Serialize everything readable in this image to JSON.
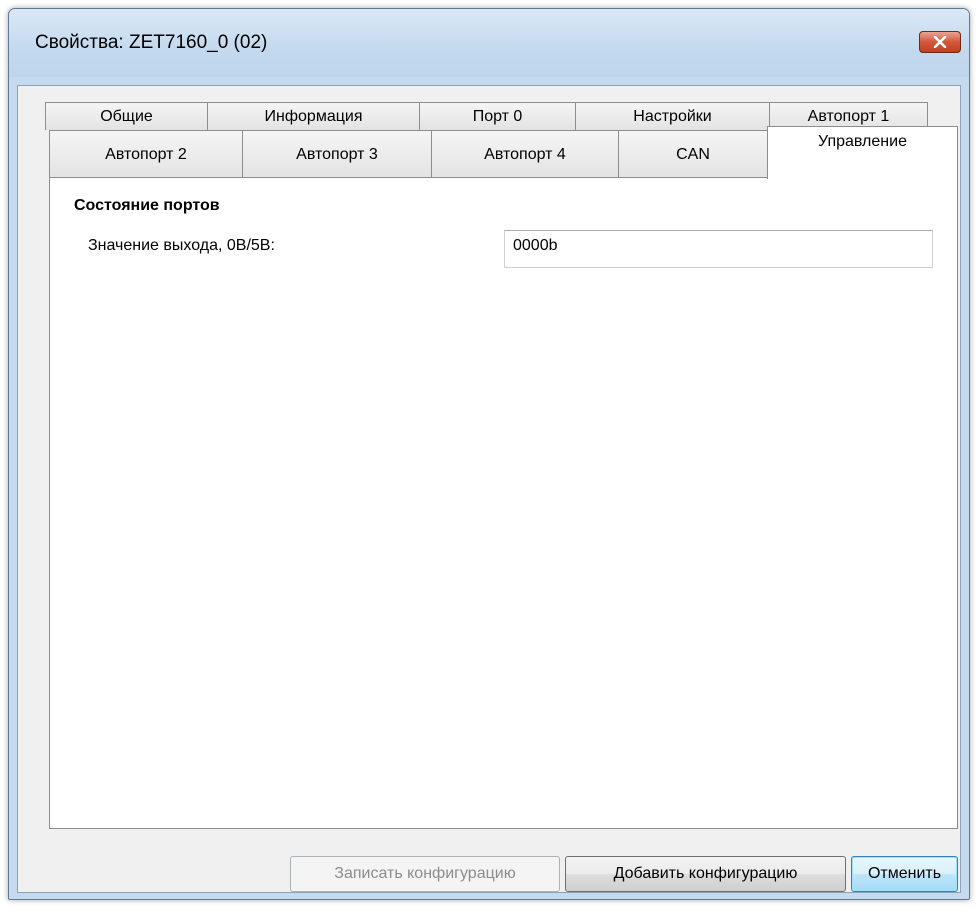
{
  "window": {
    "title": "Свойства: ZET7160_0 (02)"
  },
  "tabs": {
    "row1": [
      {
        "label": "Общие"
      },
      {
        "label": "Информация"
      },
      {
        "label": "Порт 0"
      },
      {
        "label": "Настройки"
      },
      {
        "label": "Автопорт 1"
      }
    ],
    "row2": [
      {
        "label": "Автопорт 2"
      },
      {
        "label": "Автопорт 3"
      },
      {
        "label": "Автопорт 4"
      },
      {
        "label": "CAN"
      },
      {
        "label": "Управление",
        "active": true
      }
    ]
  },
  "panel": {
    "section_title": "Состояние портов",
    "output_label": "Значение выхода, 0В/5В:",
    "output_value": "0000b"
  },
  "buttons": {
    "write_config": "Записать конфигурацию",
    "add_config": "Добавить конфигурацию",
    "cancel": "Отменить"
  },
  "colors": {
    "titlebar": "#c4d9ee",
    "close_button": "#c8462a",
    "default_button_border": "#3c7fb1"
  }
}
